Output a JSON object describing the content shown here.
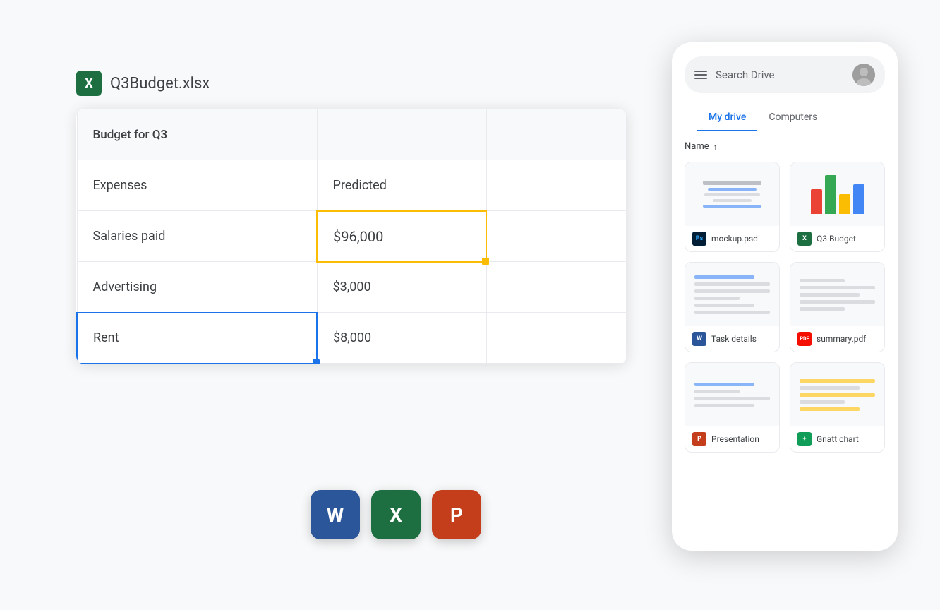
{
  "scene": {
    "background": "#f8f9fa"
  },
  "file_header": {
    "icon_label": "X",
    "file_name": "Q3Budget.xlsx"
  },
  "spreadsheet": {
    "title_row": {
      "col1": "Budget for Q3",
      "col2": "",
      "col3": ""
    },
    "header_row": {
      "col1": "Expenses",
      "col2": "Predicted",
      "col3": ""
    },
    "data_rows": [
      {
        "col1": "Salaries paid",
        "col2": "$96,000",
        "col3": "",
        "highlighted": "yellow"
      },
      {
        "col1": "Advertising",
        "col2": "$3,000",
        "col3": ""
      },
      {
        "col1": "Rent",
        "col2": "$8,000",
        "col3": "",
        "highlighted": "blue"
      }
    ]
  },
  "drive_panel": {
    "search_placeholder": "Search Drive",
    "tabs": [
      {
        "label": "My drive",
        "active": true
      },
      {
        "label": "Computers",
        "active": false
      }
    ],
    "sort": {
      "label": "Name",
      "direction": "↑"
    },
    "files": [
      {
        "name": "mockup.psd",
        "type": "ps",
        "type_label": "Ps",
        "has_chart": false
      },
      {
        "name": "Q3 Budget",
        "type": "xl",
        "type_label": "X",
        "has_chart": true
      },
      {
        "name": "Task details",
        "type": "word",
        "type_label": "W",
        "has_chart": false
      },
      {
        "name": "summary.pdf",
        "type": "pdf",
        "type_label": "PDF",
        "has_chart": false
      },
      {
        "name": "Presentation",
        "type": "ppt",
        "type_label": "P",
        "has_chart": false
      },
      {
        "name": "Gnatt chart",
        "type": "sheets",
        "type_label": "+",
        "has_chart": false
      }
    ]
  },
  "app_icons": [
    {
      "label": "W",
      "type": "word"
    },
    {
      "label": "X",
      "type": "excel"
    },
    {
      "label": "P",
      "type": "ppt"
    }
  ]
}
